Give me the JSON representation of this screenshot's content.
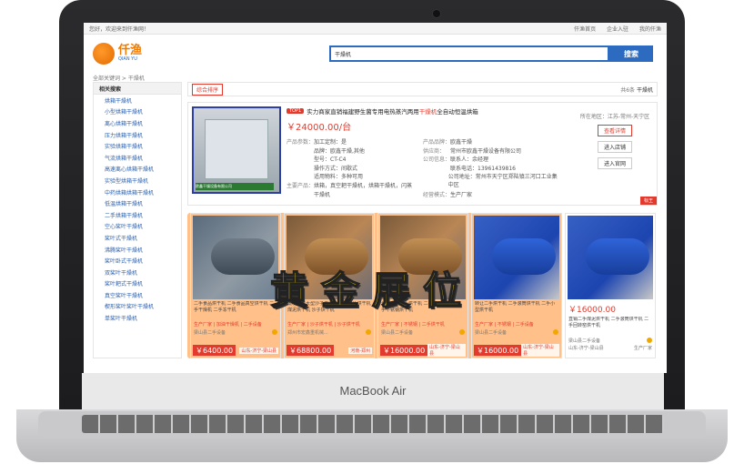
{
  "device": {
    "brand": "MacBook Air"
  },
  "topbar": {
    "welcome": "您好，欢迎来到仟渔网！",
    "links": [
      "仟渔首页",
      "企业入驻",
      "我的仟渔"
    ]
  },
  "logo": {
    "name": "仟渔",
    "sub": "QIAN YU"
  },
  "search": {
    "value": "干燥机",
    "button": "搜索"
  },
  "breadcrumb": "全部关键词 > 干燥机",
  "sidebar": {
    "title": "相关搜索",
    "items": [
      "烘箱干燥机",
      "小型烘箱干燥机",
      "离心烘箱干燥机",
      "压力烘箱干燥机",
      "实验烘箱干燥机",
      "气流烘箱干燥机",
      "高速离心烘箱干燥机",
      "实验型烘箱干燥机",
      "中药烘箱烘箱干燥机",
      "低温烘箱干燥机",
      "二手烘箱干燥机",
      "空心桨叶干燥机",
      "桨叶式干燥机",
      "沸腾桨叶干燥机",
      "桨叶卧式干燥机",
      "双桨叶干燥机",
      "桨叶耙式干燥机",
      "真空桨叶干燥机",
      "楔形桨叶桨叶干燥机",
      "单桨叶干燥机"
    ]
  },
  "tabs": {
    "active": "综合排序",
    "count_prefix": "共6条",
    "count_kw": "干燥机"
  },
  "feature": {
    "badge": "TOP1",
    "title_a": "实力商家直销福建野生菌专用电热蒸汽两用",
    "title_hl": "干燥机",
    "title_b": " 全自动恒温烘箱",
    "price": "￥24000.00/台",
    "img_caption": "欧鑫干燥设备有限公司",
    "left_rows": [
      {
        "k": "产品参数：",
        "v": "加工定制：是"
      },
      {
        "k": "",
        "v": "品牌：欧鑫干燥,其他"
      },
      {
        "k": "",
        "v": "型号：CT-C4"
      },
      {
        "k": "",
        "v": "操作方式：间歇式"
      },
      {
        "k": "",
        "v": "适用物料：多种可用"
      },
      {
        "k": "主要产品：",
        "v": "烘箱，真空耙干燥机，烘箱干燥机，闪蒸"
      },
      {
        "k": "",
        "v": "干燥机"
      }
    ],
    "right_rows": [
      {
        "k": "产品品牌：",
        "v": "欧鑫干燥"
      },
      {
        "k": "供应商：",
        "v": "常州市欧鑫干燥设备有限公司"
      },
      {
        "k": "公司信息：",
        "v": "联系人：余经理"
      },
      {
        "k": "",
        "v": "联系电话：13961439816"
      },
      {
        "k": "",
        "v": "公司地址：常州市天宁区郑陆镇三河口工业集中区"
      },
      {
        "k": "",
        "v": ""
      },
      {
        "k": "经营模式：",
        "v": "生产厂家"
      }
    ],
    "location": "所在地区：江苏-常州-天宁区",
    "buttons": [
      "查看详情",
      "进入店铺",
      "进入官网"
    ],
    "ribbon": "标王"
  },
  "watermark": "黄金展位",
  "cards": [
    {
      "desc": "二手食品烘干机 二手食品真空烘干机 二手干燥机 二手冻干机",
      "tags": "生产厂家 | 加油干燥机 | 二手设备",
      "loc": "梁山县二手设备",
      "price": "￥6400.00",
      "city": "山东-济宁-梁山县"
    },
    {
      "desc": "批发销售大型沙子烘干机 滚筒河沙烘干机 煤泥烘干机 沙子烘干机",
      "tags": "生产厂家 | 沙子烘干机 | 沙子烘干机",
      "loc": "郑州市宏鑫重机械...",
      "price": "￥68800.00",
      "city": "河南-郑州"
    },
    {
      "desc": "长期供应二手烘干机 二手工业烘干机 二手不锈钢烘干机",
      "tags": "生产厂家 | 不锈钢 | 二手烘干机",
      "loc": "梁山县二手设备",
      "price": "￥16000.00",
      "city": "山东-济宁-梁山县"
    },
    {
      "desc": "转让二手烘干机 二手滚筒烘干机 二手小型烘干机",
      "tags": "生产厂家 | 不锈钢 | 二手设备",
      "loc": "梁山县二手设备",
      "price": "￥16000.00",
      "city": "山东-济宁-梁山县"
    },
    {
      "desc": "直销二手煤泥烘干机 二手滚筒烘干机 二手回转窑烘干机",
      "price": "￥16000.00",
      "loc": "梁山县二手设备",
      "city": "山东-济宁-梁山县",
      "vendor": "生产厂家"
    }
  ]
}
